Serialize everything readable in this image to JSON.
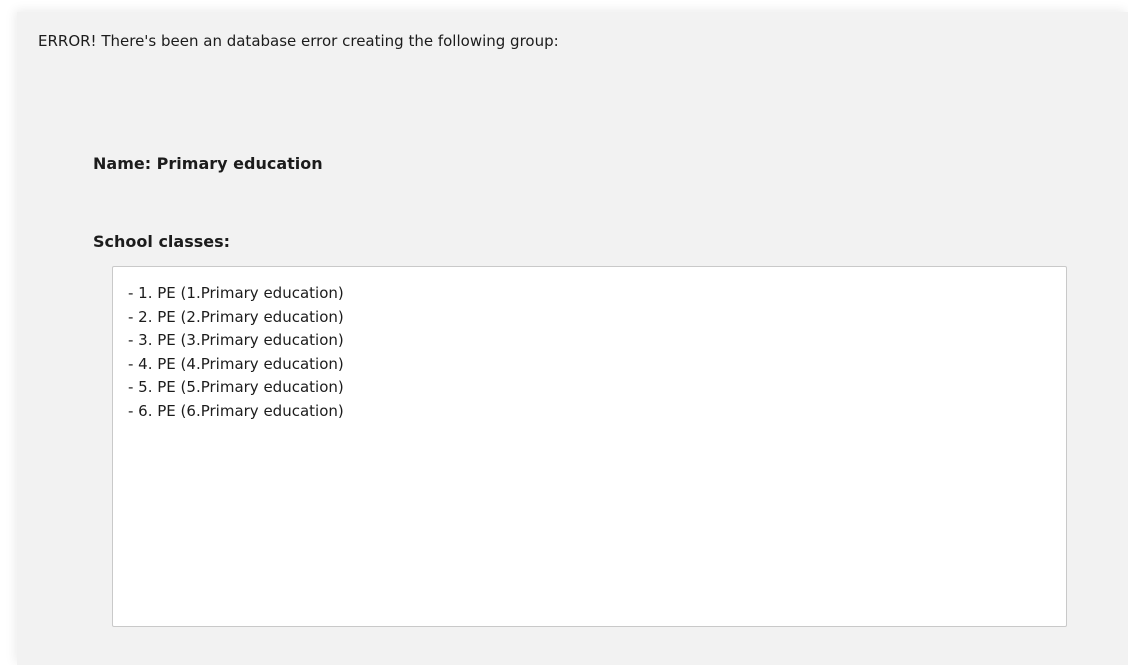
{
  "dialog": {
    "error_message": "ERROR! There's been an database error creating the following group:",
    "name_label": "Name: Primary education",
    "classes_heading": "School classes:",
    "classes": [
      "- 1. PE (1.Primary education)",
      "- 2. PE (2.Primary education)",
      "- 3. PE (3.Primary education)",
      "- 4. PE (4.Primary education)",
      "- 5. PE (5.Primary education)",
      "- 6. PE (6.Primary education)"
    ]
  }
}
